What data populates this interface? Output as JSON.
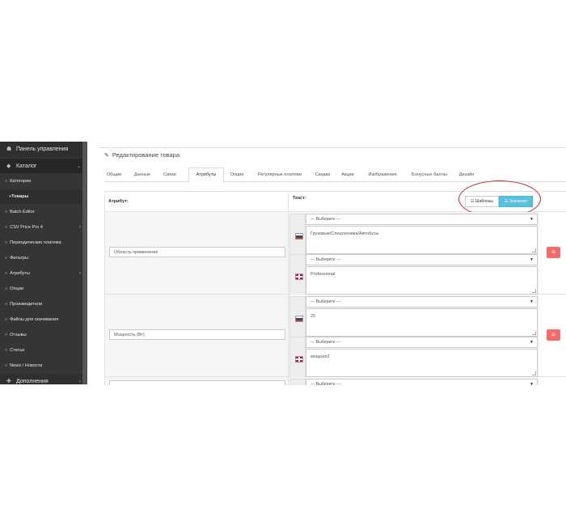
{
  "sidebar": {
    "dashboard": "Панель управления",
    "catalog": "Каталог",
    "items": [
      {
        "label": "Категории",
        "level": "sub"
      },
      {
        "label": "Товары",
        "level": "subsub"
      },
      {
        "label": "Batch Editor",
        "level": "sub"
      },
      {
        "label": "CSV Price Pro 4",
        "level": "sub",
        "chevron": "›"
      },
      {
        "label": "Периодические платежи",
        "level": "sub"
      },
      {
        "label": "Фильтры",
        "level": "sub"
      },
      {
        "label": "Атрибуты",
        "level": "sub",
        "chevron": "›"
      },
      {
        "label": "Опции",
        "level": "sub"
      },
      {
        "label": "Производители",
        "level": "sub"
      },
      {
        "label": "Файлы для скачивания",
        "level": "sub"
      },
      {
        "label": "Отзывы",
        "level": "sub"
      },
      {
        "label": "Статьи",
        "level": "sub"
      },
      {
        "label": "News / Новости",
        "level": "sub"
      }
    ],
    "extensions": "Дополнения"
  },
  "panel": {
    "title": "Редактирование товара"
  },
  "tabs": [
    "Общие",
    "Данные",
    "Связи",
    "Атрибуты",
    "Опции",
    "Регулярные платежи",
    "Скидки",
    "Акции",
    "Изображения",
    "Бонусные баллы",
    "Дизайн"
  ],
  "active_tab": "Атрибуты",
  "table": {
    "col_attribute": "Атрибут:",
    "col_text": "Текст:",
    "btn_templates": "Шаблоны",
    "btn_values": "Значения"
  },
  "rows": [
    {
      "attribute": "Область применения",
      "langs": [
        {
          "flag": "ru",
          "select": "--- Выберите ---",
          "text": "Грузовые/Спецтехника/Автобусы"
        },
        {
          "flag": "gb",
          "select": "--- Выберите ---",
          "text": "Professional"
        }
      ]
    },
    {
      "attribute": "Мощность (Вт)",
      "langs": [
        {
          "flag": "ru",
          "select": "--- Выберите ---",
          "text": "25"
        },
        {
          "flag": "gb",
          "select": "--- Выберите ---",
          "text": "мощная2"
        }
      ]
    },
    {
      "attribute": "",
      "langs": [
        {
          "flag": "ru",
          "select": "--- Выберите ---",
          "text": ""
        }
      ]
    }
  ],
  "colors": {
    "sidebar_bg": "#3c3c3c",
    "active_btn": "#5bc0de",
    "delete_btn": "#f56b6b",
    "highlight_circle": "#c0282d"
  }
}
